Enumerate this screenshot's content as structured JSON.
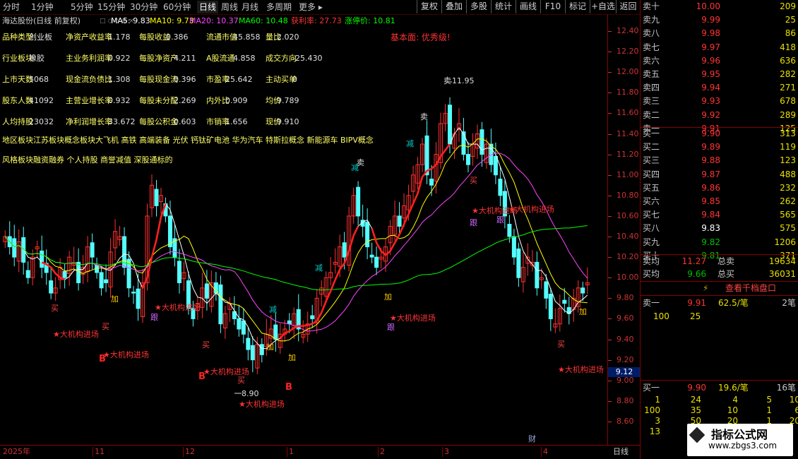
{
  "toolbar": {
    "periods": [
      "分时",
      "1分钟",
      "5分钟",
      "15分钟",
      "30分钟",
      "60分钟",
      "日线",
      "周线",
      "月线",
      "多周期",
      "更多 ▸"
    ],
    "active_period": "日线",
    "functions": [
      "复权",
      "叠加",
      "多股",
      "统计",
      "画线",
      "F10",
      "标记",
      "+自选",
      "返回"
    ]
  },
  "indicator_bar": {
    "stock": "海达股份(日线 前复权)",
    "ma5": "MA5: 9.83",
    "ma10": "MA10: 9.73",
    "ma20": "MA20: 10.37",
    "ma60": "MA60: 10.48",
    "profit_rate": "获利率: 27.73",
    "limit_up": "涨停价: 10.81",
    "icons": "□ ◇ ◇ ⊕ ×"
  },
  "fundamentals": {
    "rows": [
      [
        [
          "品种类型",
          "创业板"
        ],
        [
          "净资产收益率",
          "1.178"
        ],
        [
          "每股收益",
          "0.386"
        ],
        [
          "流通市值",
          "45.858"
        ],
        [
          "量比",
          "2.020"
        ]
      ],
      [
        [
          "行业板块",
          "橡胶"
        ],
        [
          "主业务利润率",
          "0.922"
        ],
        [
          "每股净资产",
          "4.211"
        ],
        [
          "A股流通",
          "4.858"
        ],
        [
          "成交方向",
          "-25.430"
        ]
      ],
      [
        [
          "上市天数",
          "5068"
        ],
        [
          "现金流负债比",
          "1.308"
        ],
        [
          "每股现金流",
          "0.396"
        ],
        [
          "市盈率",
          "25.642"
        ],
        [
          "主动买单",
          "0"
        ]
      ],
      [
        [
          "股东人数",
          "41092"
        ],
        [
          "主营业增长率",
          "0.932"
        ],
        [
          "每股未分配",
          "2.269"
        ],
        [
          "内外比",
          "0.909"
        ],
        [
          "均价",
          "9.789"
        ]
      ],
      [
        [
          "人均持股",
          "23032"
        ],
        [
          "净利润增长率",
          "33.672"
        ],
        [
          "每股公积金",
          "0.603"
        ],
        [
          "市销率",
          "1.656"
        ],
        [
          "现价",
          "9.910"
        ]
      ]
    ],
    "rating": "基本面: 优秀级!",
    "region_concept": "地区板块江苏板块概念板块大飞机 高铁 高端装备 光伏 钙钛矿电池 华为汽车 特斯拉概念 新能源车 BIPV概念",
    "style": "风格板块融资融券 个人持股 商誉减值 深股通标的"
  },
  "chart_labels": {
    "high": "11.95",
    "low": "8.90",
    "inst": "★大机构进场",
    "buy": "买",
    "sell": "卖",
    "add": "加",
    "reduce": "减",
    "follow": "跟",
    "b": "B",
    "fin": "财",
    "period": "日线"
  },
  "axis": {
    "ticks": [
      "12.40",
      "12.20",
      "12.00",
      "11.80",
      "11.60",
      "11.40",
      "11.20",
      "11.00",
      "10.80",
      "10.60",
      "10.40",
      "10.20",
      "10.00",
      "9.80",
      "9.60",
      "9.40",
      "9.20",
      "9.00",
      "8.80",
      "8.60"
    ],
    "current": "9.12"
  },
  "dates": [
    "2025年",
    "11",
    "12",
    "1",
    "2",
    "3",
    "4"
  ],
  "orderbook": {
    "asks": [
      {
        "label": "卖十",
        "price": "10.00",
        "vol": "209"
      },
      {
        "label": "卖九",
        "price": "9.99",
        "vol": "25"
      },
      {
        "label": "卖八",
        "price": "9.98",
        "vol": "86"
      },
      {
        "label": "卖七",
        "price": "9.97",
        "vol": "418"
      },
      {
        "label": "卖六",
        "price": "9.96",
        "vol": "636"
      },
      {
        "label": "卖五",
        "price": "9.95",
        "vol": "282"
      },
      {
        "label": "卖四",
        "price": "9.94",
        "vol": "271"
      },
      {
        "label": "卖三",
        "price": "9.93",
        "vol": "678"
      },
      {
        "label": "卖二",
        "price": "9.92",
        "vol": "289"
      },
      {
        "label": "卖一",
        "price": "9.91",
        "vol": "125"
      }
    ],
    "bids": [
      {
        "label": "买一",
        "price": "9.90",
        "vol": "313"
      },
      {
        "label": "买二",
        "price": "9.89",
        "vol": "119"
      },
      {
        "label": "买三",
        "price": "9.88",
        "vol": "123"
      },
      {
        "label": "买四",
        "price": "9.87",
        "vol": "488"
      },
      {
        "label": "买五",
        "price": "9.86",
        "vol": "232"
      },
      {
        "label": "买六",
        "price": "9.85",
        "vol": "262"
      },
      {
        "label": "买七",
        "price": "9.84",
        "vol": "565"
      },
      {
        "label": "买八",
        "price": "9.83",
        "vol": "575"
      },
      {
        "label": "买九",
        "price": "9.82",
        "vol": "1206"
      },
      {
        "label": "买十",
        "price": "9.81",
        "vol": "371"
      }
    ],
    "avg_sell_label": "卖均",
    "avg_sell": "11.27",
    "total_sell_label": "总卖",
    "total_sell": "19634",
    "avg_buy_label": "买均",
    "avg_buy": "9.66",
    "total_buy_label": "总买",
    "total_buy": "36031",
    "view_btn": "查看千档盘口",
    "queue_sell": {
      "label": "卖一",
      "price": "9.91",
      "size": "62.5/笔",
      "count": "2笔",
      "q1": "100",
      "q2": "25"
    },
    "queue_buy": {
      "label": "买一",
      "price": "9.90",
      "size": "19.6/笔",
      "count": "16笔",
      "rows": [
        [
          "1",
          "24",
          "4",
          "5",
          "10"
        ],
        [
          "100",
          "35",
          "10",
          "1",
          "6"
        ],
        [
          "3",
          "50",
          "20",
          "1",
          "20"
        ],
        [
          "13",
          "",
          "",
          "",
          ""
        ]
      ]
    },
    "watermark1": "指标公式网",
    "watermark2": "www.zbgs3.com"
  }
}
